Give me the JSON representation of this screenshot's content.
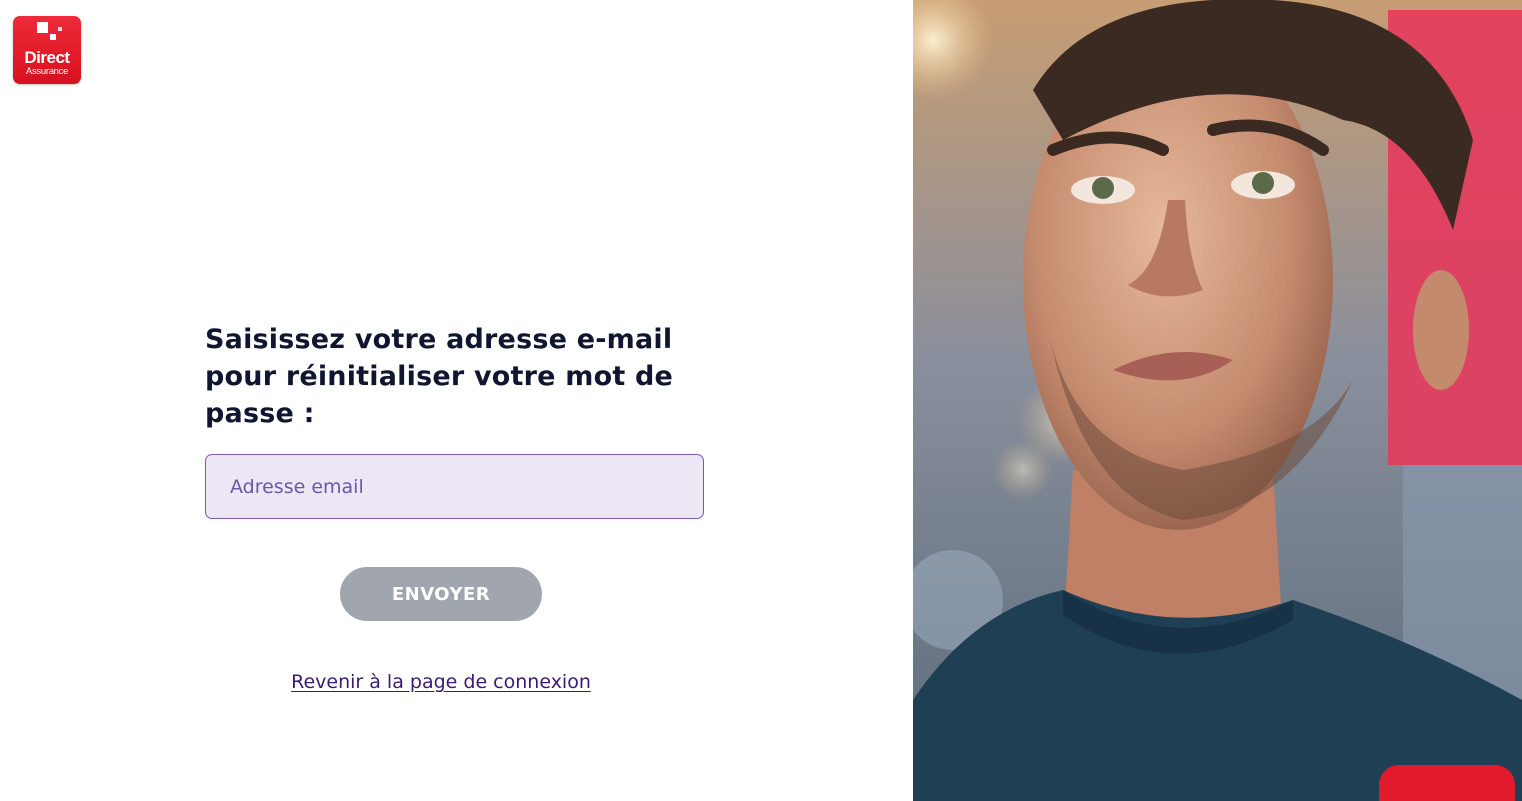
{
  "brand": {
    "logo_line1": "Direct",
    "logo_line2": "Assurance",
    "primary_color": "#e3131f"
  },
  "form": {
    "heading": "Saisissez votre adresse e-mail pour réinitialiser votre mot de passe :",
    "email_placeholder": "Adresse email",
    "email_value": "",
    "submit_label": "ENVOYER",
    "back_link": "Revenir à la page de connexion"
  },
  "colors": {
    "heading": "#101630",
    "input_bg": "#ece6f5",
    "input_border": "#7d55b8",
    "button_disabled": "#a1a5ad",
    "link": "#3d1a72"
  },
  "photo": {
    "description_icon": "man-looking-up-photo"
  }
}
